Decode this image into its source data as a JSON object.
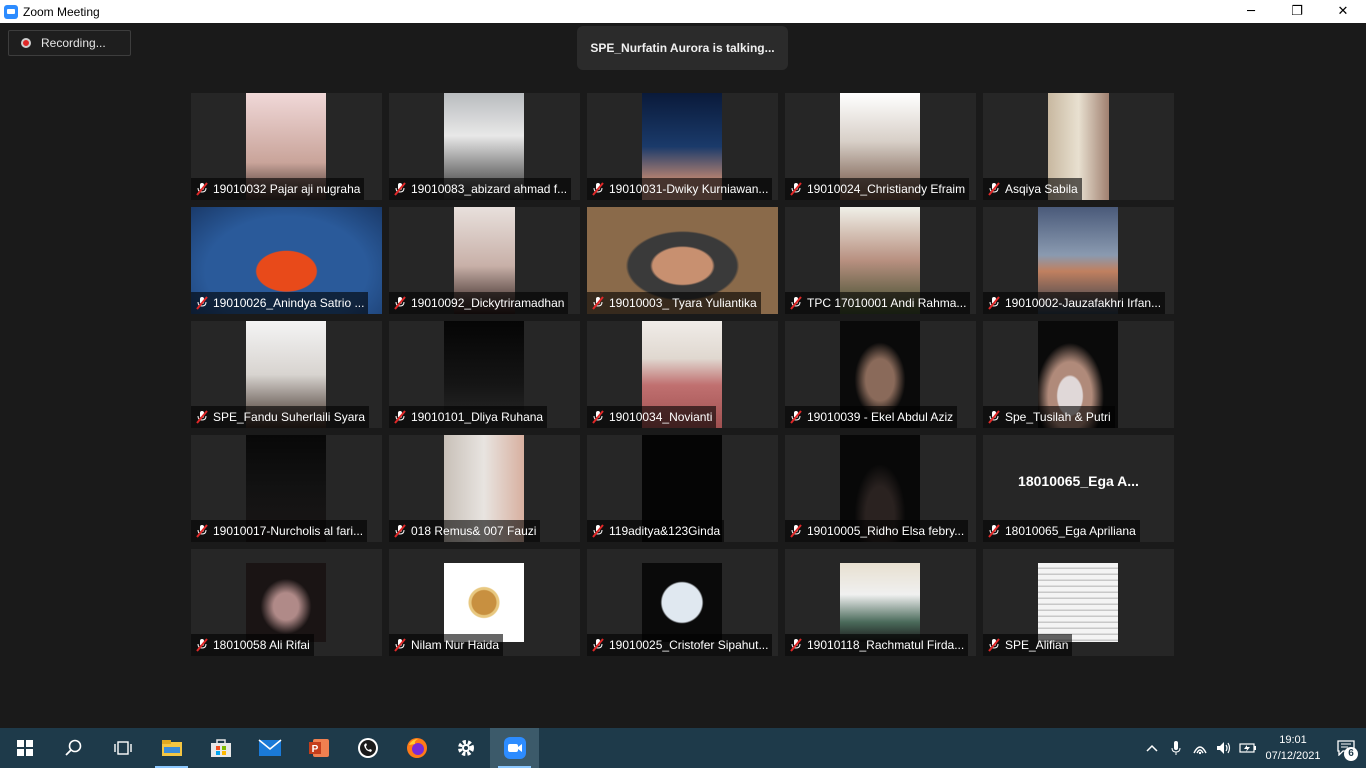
{
  "window": {
    "title": "Zoom Meeting",
    "minimize_glyph": "─",
    "restore_glyph": "❐",
    "close_glyph": "✕"
  },
  "recording": {
    "label": "Recording..."
  },
  "active_speaker": {
    "text": "SPE_Nurfatin Aurora is talking..."
  },
  "participants": [
    {
      "name": "19010032 Pajar aji nugraha"
    },
    {
      "name": "19010083_abizard ahmad f..."
    },
    {
      "name": "19010031-Dwiky Kurniawan..."
    },
    {
      "name": "19010024_Christiandy Efraim"
    },
    {
      "name": "Asqiya Sabila"
    },
    {
      "name": "19010026_Anindya Satrio ..."
    },
    {
      "name": "19010092_Dickytriramadhan"
    },
    {
      "name": "19010003_ Tyara Yuliantika"
    },
    {
      "name": "TPC 17010001 Andi Rahma..."
    },
    {
      "name": "19010002-Jauzafakhri Irfan..."
    },
    {
      "name": "SPE_Fandu Suherlaili Syara"
    },
    {
      "name": "19010101_Dliya Ruhana"
    },
    {
      "name": "19010034_Novianti"
    },
    {
      "name": "19010039 - Ekel Abdul Aziz"
    },
    {
      "name": "Spe_Tusilah & Putri"
    },
    {
      "name": "19010017-Nurcholis al fari..."
    },
    {
      "name": "018 Remus& 007 Fauzi"
    },
    {
      "name": "119aditya&123Ginda"
    },
    {
      "name": "19010005_Ridho Elsa febry..."
    },
    {
      "name": "18010065_Ega Apriliana",
      "placeholder_name": "18010065_Ega A..."
    },
    {
      "name": "18010058 Ali Rifai"
    },
    {
      "name": "Nilam Nur Haida"
    },
    {
      "name": "19010025_Cristofer Sipahut..."
    },
    {
      "name": "19010118_Rachmatul Firda..."
    },
    {
      "name": "SPE_Alifian"
    }
  ],
  "taskbar": {
    "icons": [
      "windows-start-icon",
      "search-icon",
      "task-view-icon",
      "file-explorer-icon",
      "microsoft-store-icon",
      "mail-icon",
      "powerpoint-icon",
      "whatsapp-icon",
      "firefox-icon",
      "settings-icon",
      "zoom-icon"
    ],
    "clock_time": "19:01",
    "clock_date": "07/12/2021",
    "notification_count": "6"
  }
}
